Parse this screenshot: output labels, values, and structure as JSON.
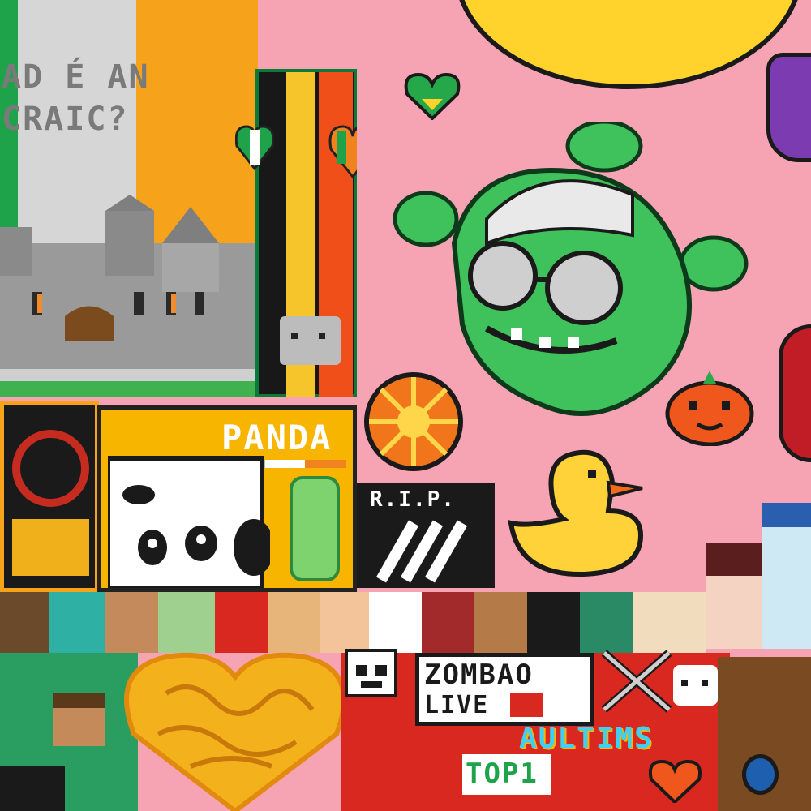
{
  "texts": {
    "irish_line1": "AD É AN",
    "irish_line2": "CRAIC?",
    "panda": "PANDA",
    "rip": "R.I.P.",
    "zombao_line1": "ZOMBAO",
    "zombao_line2": "LIVE",
    "top1": "TOP1",
    "brand": "AULTIMS"
  },
  "colors": {
    "pink_background": "#f6a3b4",
    "irish_green": "#169b62",
    "irish_orange": "#ff883e",
    "panda_yellow": "#f7b500",
    "zombao_red": "#d8281f",
    "character_green": "#2fbf5a"
  },
  "icons": [
    "castle-icon",
    "rubber-duck-icon",
    "panda-icon",
    "green-character-icon",
    "orange-fruit-icon",
    "heart-icon",
    "skull-icon",
    "wolf-icon"
  ]
}
